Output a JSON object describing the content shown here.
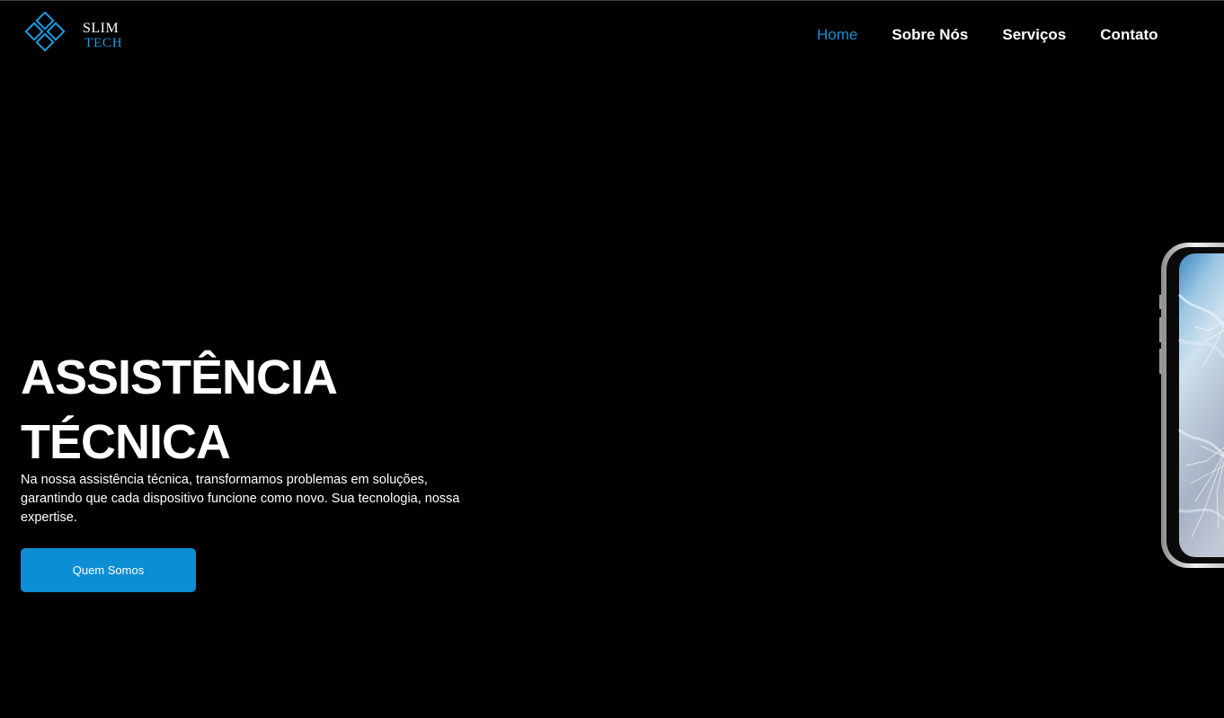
{
  "brand": {
    "line1": "SLIM",
    "line2": "TECH",
    "icon": "diamond-grid-logo-icon",
    "accent_color": "#1a9be0"
  },
  "nav": {
    "items": [
      {
        "label": "Home",
        "active": true
      },
      {
        "label": "Sobre Nós",
        "active": false
      },
      {
        "label": "Serviços",
        "active": false
      },
      {
        "label": "Contato",
        "active": false
      }
    ],
    "active_color": "#1a8fd1"
  },
  "hero": {
    "title_line1": "ASSISTÊNCIA",
    "title_line2": "TÉCNICA",
    "description": "Na nossa assistência técnica, transformamos problemas em soluções, garantindo que cada dispositivo funcione como novo. Sua tecnologia, nossa expertise.",
    "button_label": "Quem Somos",
    "button_color": "#0b8ed3",
    "image": "cracked-smartphone-image"
  },
  "colors": {
    "background": "#000000",
    "text": "#ffffff"
  }
}
